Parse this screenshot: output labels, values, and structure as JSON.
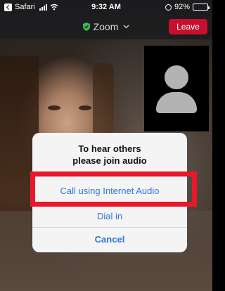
{
  "status_bar": {
    "carrier": "Safari",
    "time": "9:32 AM",
    "battery": "92%",
    "battery_level": 0.92
  },
  "top_bar": {
    "app_title": "Zoom",
    "leave_label": "Leave"
  },
  "dialog": {
    "title_line1": "To hear others",
    "title_line2": "please join audio",
    "options": [
      {
        "label": "Call using Internet Audio"
      },
      {
        "label": "Dial in"
      },
      {
        "label": "Cancel"
      }
    ]
  },
  "colors": {
    "leave": "#c8102e",
    "link": "#2d76d8",
    "highlight": "#e8182a",
    "secure_shield": "#3fb950"
  }
}
